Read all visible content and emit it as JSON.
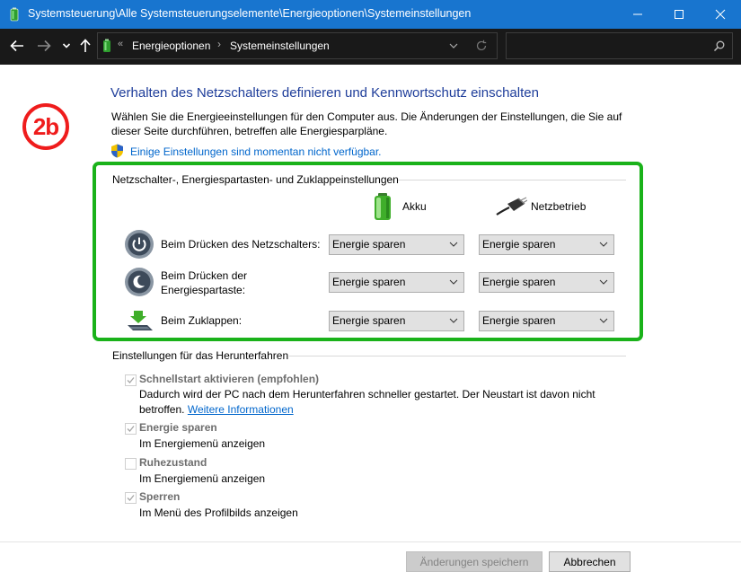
{
  "window": {
    "title": "Systemsteuerung\\Alle Systemsteuerungselemente\\Energieoptionen\\Systemeinstellungen",
    "titlebar_color": "#1875cf"
  },
  "address_bar": {
    "overflow": "«",
    "crumbs": [
      "Energieoptionen",
      "Systemeinstellungen"
    ],
    "separator": "›"
  },
  "search": {
    "placeholder": ""
  },
  "badge": {
    "text": "2b",
    "color": "#ef1c1c"
  },
  "content": {
    "heading": "Verhalten des Netzschalters definieren und Kennwortschutz einschalten",
    "description": "Wählen Sie die Energieeinstellungen für den Computer aus. Die Änderungen der Einstellungen, die Sie auf dieser Seite durchführen, betreffen alle Energiesparpläne.",
    "unavailable_link": "Einige Einstellungen sind momentan nicht verfügbar.",
    "highlight_color": "#1ab21a"
  },
  "buttons_group": {
    "title": "Netzschalter-, Energiespartasten- und Zuklappeinstellungen",
    "columns": [
      "Akku",
      "Netzbetrieb"
    ],
    "rows": [
      {
        "label": "Beim Drücken des Netzschalters:",
        "akku": "Energie sparen",
        "netz": "Energie sparen"
      },
      {
        "label": "Beim Drücken der Energiespartaste:",
        "akku": "Energie sparen",
        "netz": "Energie sparen"
      },
      {
        "label": "Beim Zuklappen:",
        "akku": "Energie sparen",
        "netz": "Energie sparen"
      }
    ]
  },
  "shutdown": {
    "title": "Einstellungen für das Herunterfahren",
    "items": [
      {
        "label": "Schnellstart aktivieren (empfohlen)",
        "checked": true,
        "desc": "Dadurch wird der PC nach dem Herunterfahren schneller gestartet. Der Neustart ist davon nicht betroffen.",
        "link": "Weitere Informationen"
      },
      {
        "label": "Energie sparen",
        "checked": true,
        "desc": "Im Energiemenü anzeigen"
      },
      {
        "label": "Ruhezustand",
        "checked": false,
        "desc": "Im Energiemenü anzeigen"
      },
      {
        "label": "Sperren",
        "checked": true,
        "desc": "Im Menü des Profilbilds anzeigen"
      }
    ]
  },
  "footer": {
    "save_label": "Änderungen speichern",
    "cancel_label": "Abbrechen"
  }
}
